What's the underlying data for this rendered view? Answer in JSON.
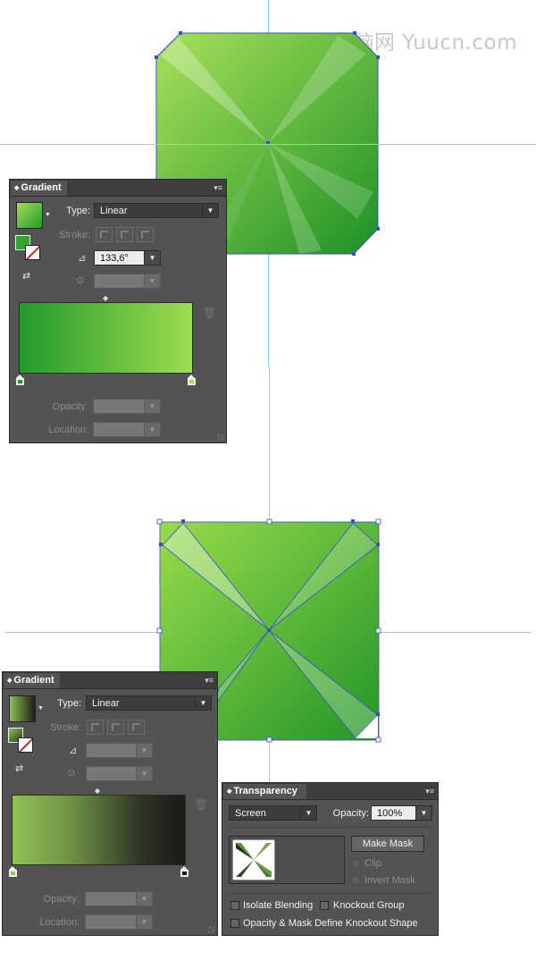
{
  "watermark": "电脑网 Yuucn.com",
  "top_panel": {
    "tab": "Gradient",
    "type_label": "Type:",
    "type_value": "Linear",
    "stroke_label": "Stroke:",
    "angle_value": "133,6°",
    "opacity_label": "Opacity:",
    "location_label": "Location:"
  },
  "bottom_gradient": {
    "tab": "Gradient",
    "type_label": "Type:",
    "type_value": "Linear",
    "stroke_label": "Stroke:",
    "opacity_label": "Opacity:",
    "location_label": "Location:"
  },
  "transparency": {
    "tab": "Transparency",
    "blend_mode": "Screen",
    "opacity_label": "Opacity:",
    "opacity_value": "100%",
    "make_mask": "Make Mask",
    "clip": "Clip",
    "invert_mask": "Invert Mask",
    "isolate_blending": "Isolate Blending",
    "knockout_group": "Knockout Group",
    "opacity_mask_knockout": "Opacity & Mask Define Knockout Shape"
  },
  "colors": {
    "green_light": "#9ddc4e",
    "green_dark": "#229628",
    "selection": "#3a4cd8",
    "guide": "#6ee4e4",
    "panel_bg": "#535353"
  }
}
